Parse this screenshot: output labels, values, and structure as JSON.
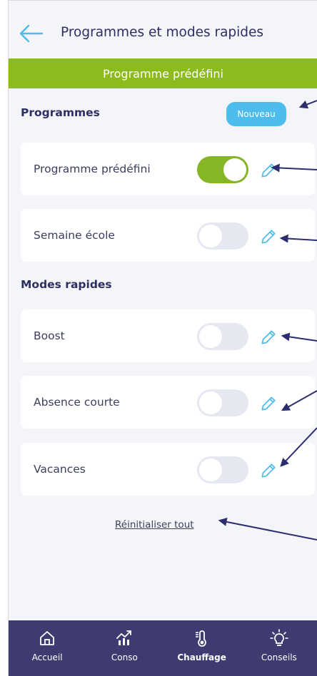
{
  "header": {
    "title": "Programmes et modes rapides",
    "back_icon": "arrow-left-icon"
  },
  "banner": {
    "text": "Programme prédéfini",
    "color": "#8dbb1e"
  },
  "programmes": {
    "title": "Programmes",
    "new_button": "Nouveau",
    "items": [
      {
        "label": "Programme prédéfini",
        "active": true
      },
      {
        "label": "Semaine école",
        "active": false
      }
    ]
  },
  "modes": {
    "title": "Modes rapides",
    "items": [
      {
        "label": "Boost",
        "active": false
      },
      {
        "label": "Absence courte",
        "active": false
      },
      {
        "label": "Vacances",
        "active": false
      }
    ]
  },
  "reset_link": "Réinitialiser tout",
  "nav": {
    "items": [
      {
        "label": "Accueil",
        "icon": "home-icon",
        "active": false
      },
      {
        "label": "Conso",
        "icon": "chart-icon",
        "active": false
      },
      {
        "label": "Chauffage",
        "icon": "thermometer-icon",
        "active": true
      },
      {
        "label": "Conseils",
        "icon": "lightbulb-icon",
        "active": false
      }
    ]
  },
  "colors": {
    "accent": "#4cbcec",
    "toggle_on": "#86b525",
    "nav_bg": "#3e3b70",
    "title_text": "#2c2f63",
    "annotation": "#2b2d6e"
  }
}
